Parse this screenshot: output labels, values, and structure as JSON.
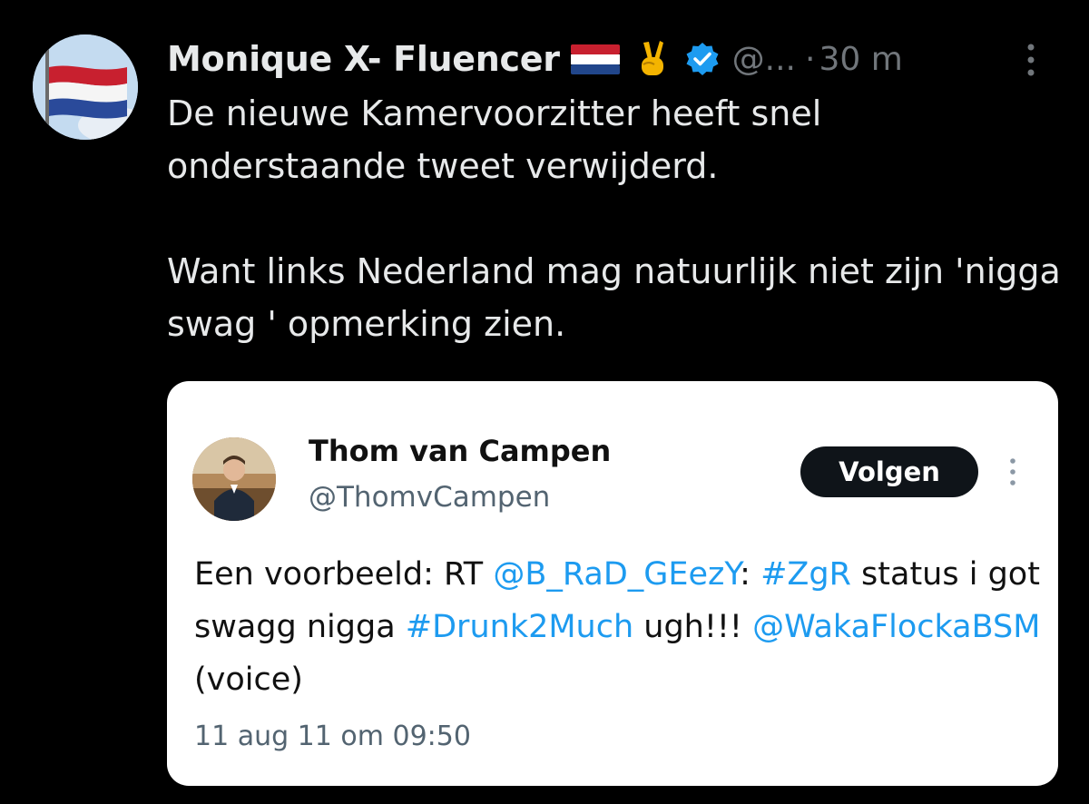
{
  "author": {
    "display_name": "Monique X- Fluencer",
    "flag_emoji": "netherlands-flag-emoji",
    "peace_emoji": "victory-hand-emoji",
    "verified": true,
    "handle": "@...",
    "separator": "·",
    "time": "30 m"
  },
  "tweet": {
    "line1": "De nieuwe Kamervoorzitter heeft snel onderstaande tweet verwijderd.",
    "line2": "Want links Nederland mag natuurlijk niet zijn 'nigga swag ' opmerking zien."
  },
  "quote": {
    "name": "Thom van Campen",
    "handle": "@ThomvCampen",
    "follow_label": "Volgen",
    "body": {
      "t1": "Een voorbeeld: RT ",
      "mention1": "@B_RaD_GEezY",
      "t2": ": ",
      "hashtag1": "#ZgR",
      "t3": " status i got swagg nigga ",
      "hashtag2": "#Drunk2Much",
      "t4": " ugh!!! ",
      "mention2": "@WakaFlockaBSM",
      "t5": " (voice)"
    },
    "date": "11 aug 11 om 09:50"
  },
  "colors": {
    "background": "#000000",
    "text": "#e7e9ea",
    "muted": "#71767b",
    "link": "#1d9bf0",
    "verified": "#1d9bf0",
    "card": "#ffffff"
  }
}
